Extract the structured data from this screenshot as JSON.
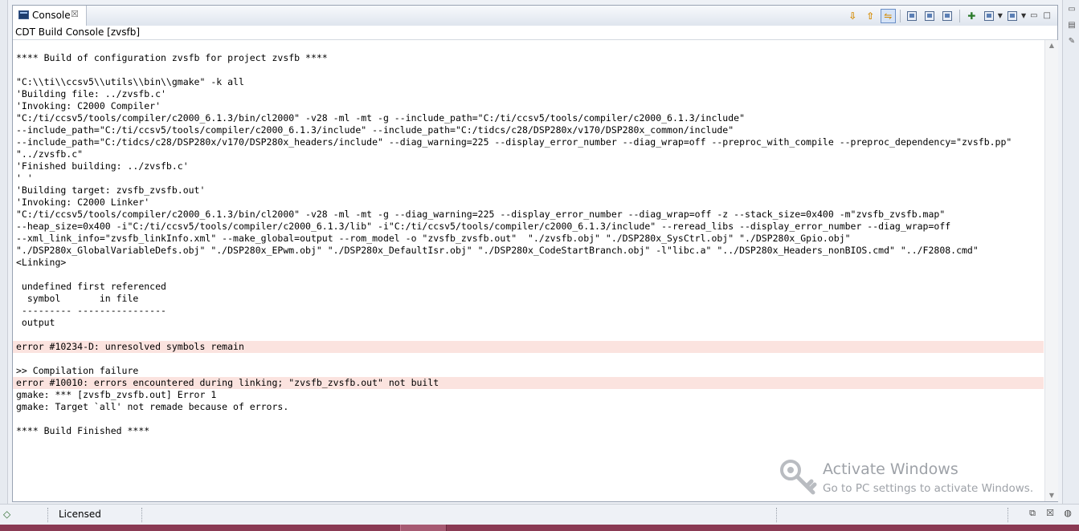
{
  "view": {
    "tab_label": "Console",
    "tab_close": "☒",
    "subtitle": "CDT Build Console [zvsfb]"
  },
  "toolbar": {
    "icons": [
      "scroll-down-icon",
      "scroll-up-icon",
      "scroll-lock-icon",
      "clear-console-icon",
      "pin-console-icon",
      "copy-build-log-icon",
      "new-console-icon",
      "display-console-icon",
      "open-console-icon",
      "minimize-icon",
      "maximize-icon"
    ],
    "minimize": "▭",
    "maximize": "□"
  },
  "console": {
    "lines": [
      {
        "text": "",
        "error": false
      },
      {
        "text": "**** Build of configuration zvsfb for project zvsfb ****",
        "error": false
      },
      {
        "text": "",
        "error": false
      },
      {
        "text": "\"C:\\\\ti\\\\ccsv5\\\\utils\\\\bin\\\\gmake\" -k all",
        "error": false
      },
      {
        "text": "'Building file: ../zvsfb.c'",
        "error": false
      },
      {
        "text": "'Invoking: C2000 Compiler'",
        "error": false
      },
      {
        "text": "\"C:/ti/ccsv5/tools/compiler/c2000_6.1.3/bin/cl2000\" -v28 -ml -mt -g --include_path=\"C:/ti/ccsv5/tools/compiler/c2000_6.1.3/include\"",
        "error": false
      },
      {
        "text": "--include_path=\"C:/ti/ccsv5/tools/compiler/c2000_6.1.3/include\" --include_path=\"C:/tidcs/c28/DSP280x/v170/DSP280x_common/include\"",
        "error": false
      },
      {
        "text": "--include_path=\"C:/tidcs/c28/DSP280x/v170/DSP280x_headers/include\" --diag_warning=225 --display_error_number --diag_wrap=off --preproc_with_compile --preproc_dependency=\"zvsfb.pp\"",
        "error": false
      },
      {
        "text": "\"../zvsfb.c\"",
        "error": false
      },
      {
        "text": "'Finished building: ../zvsfb.c'",
        "error": false
      },
      {
        "text": "' '",
        "error": false
      },
      {
        "text": "'Building target: zvsfb_zvsfb.out'",
        "error": false
      },
      {
        "text": "'Invoking: C2000 Linker'",
        "error": false
      },
      {
        "text": "\"C:/ti/ccsv5/tools/compiler/c2000_6.1.3/bin/cl2000\" -v28 -ml -mt -g --diag_warning=225 --display_error_number --diag_wrap=off -z --stack_size=0x400 -m\"zvsfb_zvsfb.map\"",
        "error": false
      },
      {
        "text": "--heap_size=0x400 -i\"C:/ti/ccsv5/tools/compiler/c2000_6.1.3/lib\" -i\"C:/ti/ccsv5/tools/compiler/c2000_6.1.3/include\" --reread_libs --display_error_number --diag_wrap=off",
        "error": false
      },
      {
        "text": "--xml_link_info=\"zvsfb_linkInfo.xml\" --make_global=output --rom_model -o \"zvsfb_zvsfb.out\"  \"./zvsfb.obj\" \"./DSP280x_SysCtrl.obj\" \"./DSP280x_Gpio.obj\"",
        "error": false
      },
      {
        "text": "\"./DSP280x_GlobalVariableDefs.obj\" \"./DSP280x_EPwm.obj\" \"./DSP280x_DefaultIsr.obj\" \"./DSP280x_CodeStartBranch.obj\" -l\"libc.a\" \"../DSP280x_Headers_nonBIOS.cmd\" \"../F2808.cmd\"",
        "error": false
      },
      {
        "text": "<Linking>",
        "error": false
      },
      {
        "text": "",
        "error": false
      },
      {
        "text": " undefined first referenced",
        "error": false
      },
      {
        "text": "  symbol       in file",
        "error": false
      },
      {
        "text": " --------- ----------------",
        "error": false
      },
      {
        "text": " output",
        "error": false
      },
      {
        "text": "",
        "error": false
      },
      {
        "text": "error #10234-D: unresolved symbols remain",
        "error": true
      },
      {
        "text": "",
        "error": false
      },
      {
        "text": ">> Compilation failure",
        "error": false
      },
      {
        "text": "error #10010: errors encountered during linking; \"zvsfb_zvsfb.out\" not built",
        "error": true
      },
      {
        "text": "gmake: *** [zvsfb_zvsfb.out] Error 1",
        "error": false
      },
      {
        "text": "gmake: Target `all' not remade because of errors.",
        "error": false
      },
      {
        "text": "",
        "error": false
      },
      {
        "text": "**** Build Finished ****",
        "error": false
      }
    ]
  },
  "watermark": {
    "title": "Activate Windows",
    "subtitle": "Go to PC settings to activate Windows."
  },
  "status": {
    "text": "Licensed"
  },
  "colors": {
    "error_highlight": "#fbe3df",
    "frame_border": "#99a3b3"
  }
}
